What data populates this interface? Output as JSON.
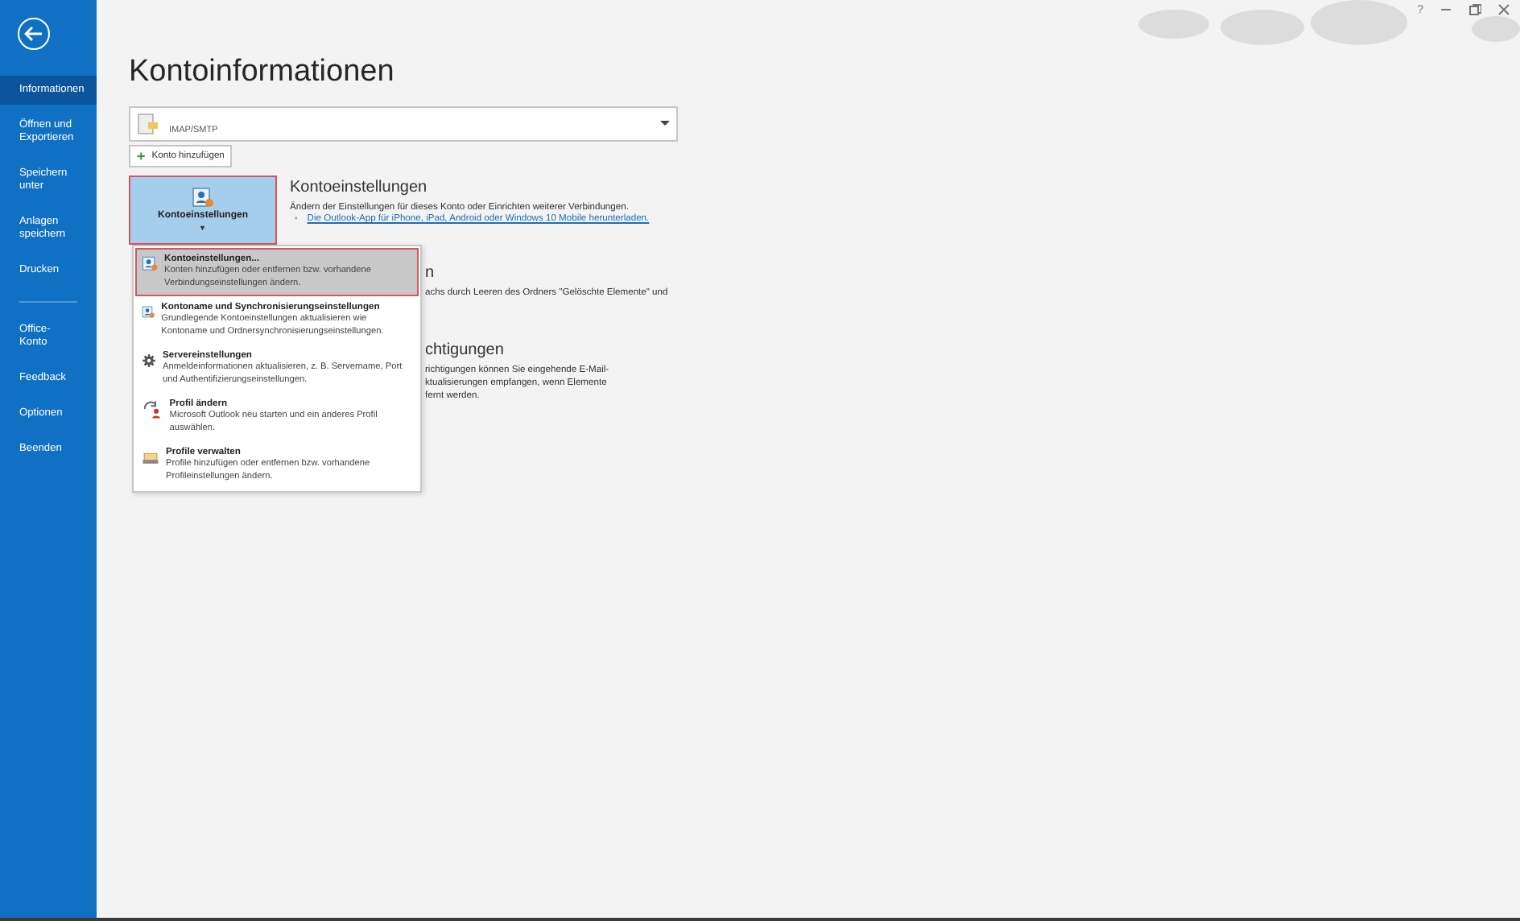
{
  "sidebar": {
    "back_button": true,
    "items": [
      {
        "label": "Informationen",
        "selected": true
      },
      {
        "label": "Öffnen und Exportieren",
        "selected": false
      },
      {
        "label": "Speichern unter",
        "selected": false
      },
      {
        "label": "Anlagen speichern",
        "selected": false
      },
      {
        "label": "Drucken",
        "selected": false,
        "divider_after": true
      },
      {
        "label": "Office-Konto",
        "selected": false
      },
      {
        "label": "Feedback",
        "selected": false
      },
      {
        "label": "Optionen",
        "selected": false
      },
      {
        "label": "Beenden",
        "selected": false
      }
    ]
  },
  "title_bar": {
    "help": "?"
  },
  "page_title": "Kontoinformationen",
  "account_select": {
    "value": "IMAP/SMTP"
  },
  "add_account": {
    "label": "Konto hinzufügen",
    "icon": "+"
  },
  "account_settings": {
    "button": {
      "label": "Kontoeinstellungen",
      "caret": "▾",
      "selected": true
    },
    "heading": "Kontoeinstellungen",
    "description": "Ändern der Einstellungen für dieses Konto oder Einrichten weiterer Verbindungen.",
    "bullet": "▪",
    "link": "Die Outlook-App für iPhone, iPad, Android oder Windows 10 Mobile herunterladen."
  },
  "hidden_sections": [
    {
      "heading": "n",
      "lines": [
        "achs durch Leeren des Ordners \"Gelöschte Elemente\" und"
      ]
    },
    {
      "heading": "chtigungen",
      "lines": [
        "richtigungen können Sie eingehende E-Mail-",
        "ktualisierungen empfangen, wenn Elemente",
        "fernt werden."
      ]
    }
  ],
  "menu": {
    "items": [
      {
        "kind": "account",
        "title": "Kontoeinstellungen...",
        "text": "Konten hinzufügen oder entfernen bzw. vorhandene Verbindungseinstellungen ändern.",
        "selected": true
      },
      {
        "kind": "account",
        "title": "Kontoname und Synchronisierungseinstellungen",
        "text": "Grundlegende Kontoeinstellungen aktualisieren wie Kontoname und Ordnersynchronisierungseinstellungen.",
        "selected": false
      },
      {
        "kind": "server",
        "title": "Servereinstellungen",
        "text": "Anmeldeinformationen aktualisieren, z. B. Servername, Port und Authentifizierungseinstellungen.",
        "selected": false
      },
      {
        "kind": "profile",
        "title": "Profil ändern",
        "text": "Microsoft Outlook neu starten und ein anderes Profil auswählen.",
        "selected": false
      },
      {
        "kind": "profiles",
        "title": "Profile verwalten",
        "text": "Profile hinzufügen oder entfernen bzw. vorhandene Profileinstellungen ändern.",
        "selected": false
      }
    ]
  }
}
